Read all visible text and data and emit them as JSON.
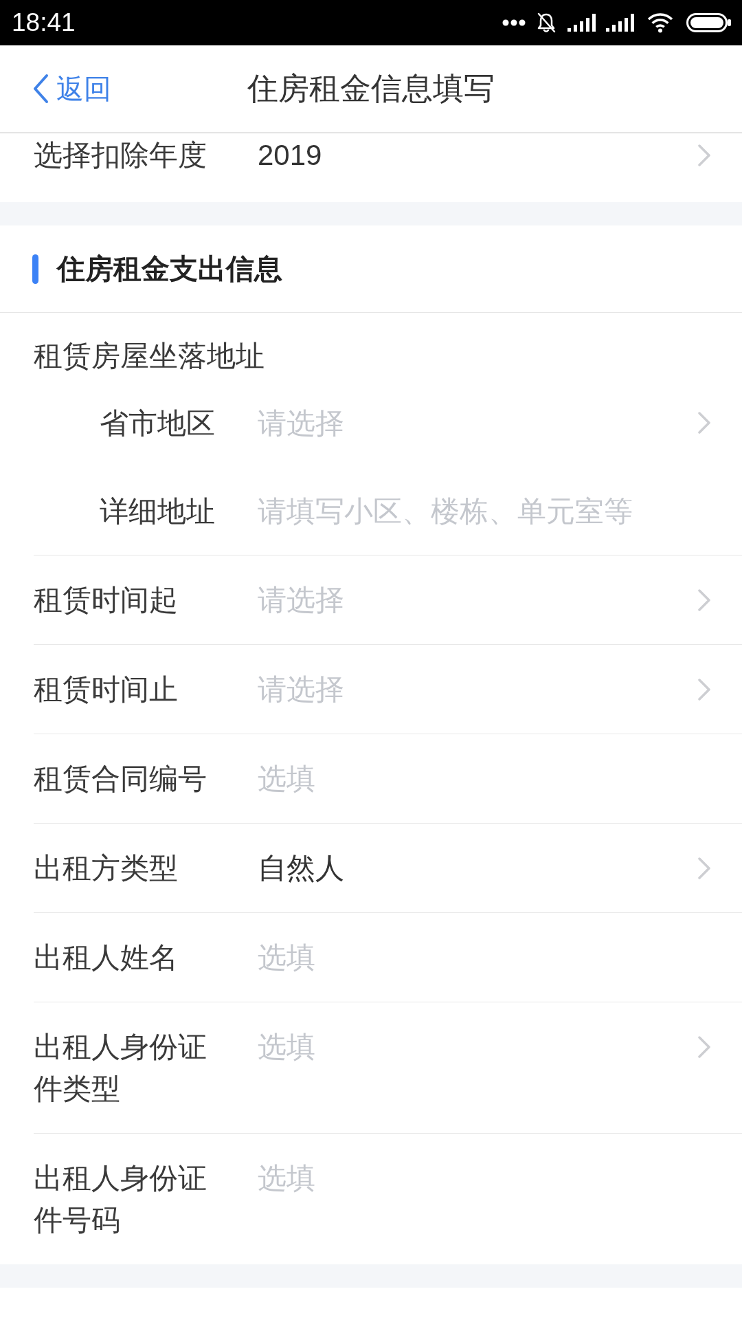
{
  "status_bar": {
    "time": "18:41"
  },
  "nav_bar": {
    "back_label": "返回",
    "title": "住房租金信息填写"
  },
  "year_row": {
    "kind": "select",
    "label": "选择扣除年度",
    "value": "2019"
  },
  "sections": [
    {
      "title": "住房租金支出信息",
      "fields": [
        {
          "kind": "group",
          "label": "租赁房屋坐落地址",
          "children": [
            {
              "kind": "select",
              "label": "省市地区",
              "placeholder": "请选择"
            },
            {
              "kind": "input",
              "label": "详细地址",
              "placeholder": "请填写小区、楼栋、单元室等"
            }
          ]
        },
        {
          "kind": "select",
          "label": "租赁时间起",
          "placeholder": "请选择"
        },
        {
          "kind": "select",
          "label": "租赁时间止",
          "placeholder": "请选择"
        },
        {
          "kind": "input",
          "label": "租赁合同编号",
          "placeholder": "选填"
        },
        {
          "kind": "select",
          "label": "出租方类型",
          "value": "自然人"
        },
        {
          "kind": "input",
          "label": "出租人姓名",
          "placeholder": "选填"
        },
        {
          "kind": "select",
          "label": "出租人身份证件类型",
          "placeholder": "选填"
        },
        {
          "kind": "input",
          "label": "出租人身份证件号码",
          "placeholder": "选填"
        }
      ]
    }
  ]
}
